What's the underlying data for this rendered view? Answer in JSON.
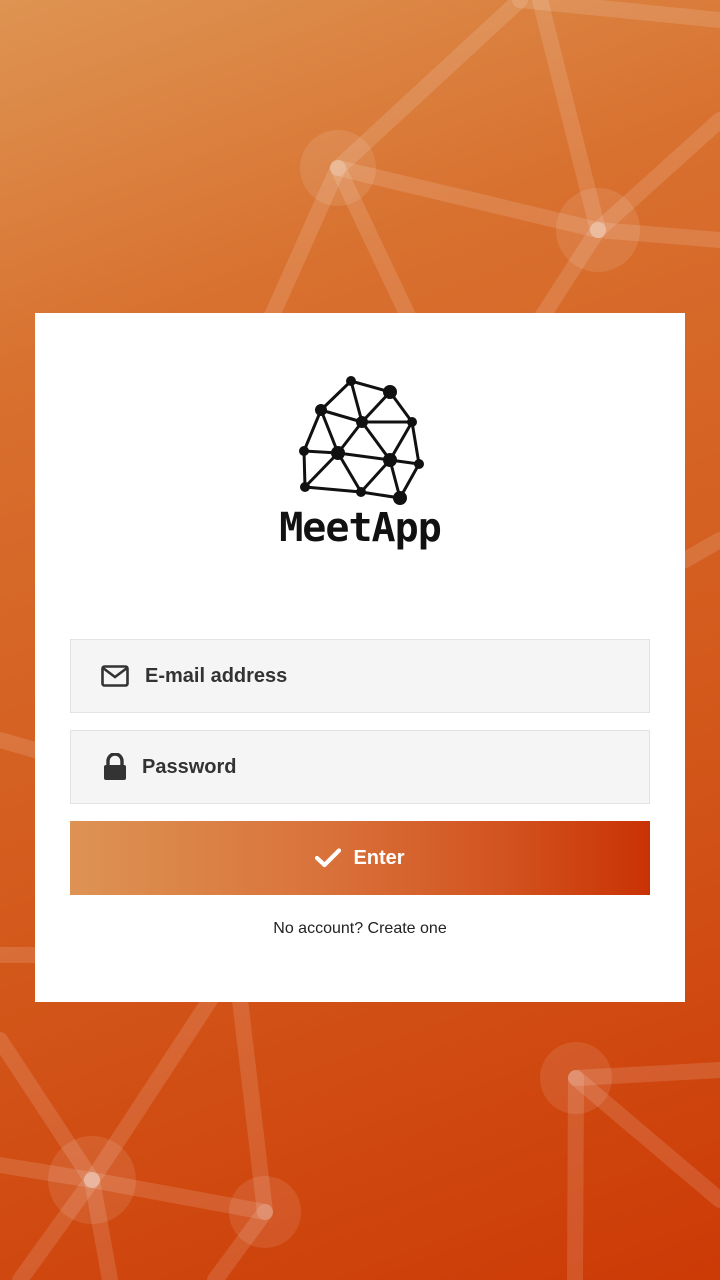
{
  "brand": {
    "name": "MeetApp"
  },
  "login": {
    "email_placeholder": "E-mail address",
    "email_icon": "envelope-icon",
    "password_placeholder": "Password",
    "password_icon": "lock-icon",
    "submit_label": "Enter",
    "submit_icon": "checkmark-icon",
    "signup_link": "No account? Create one"
  },
  "colors": {
    "accent_start": "#dd9354",
    "accent_end": "#c93204",
    "card_bg": "#ffffff",
    "field_bg": "#f5f5f5"
  }
}
